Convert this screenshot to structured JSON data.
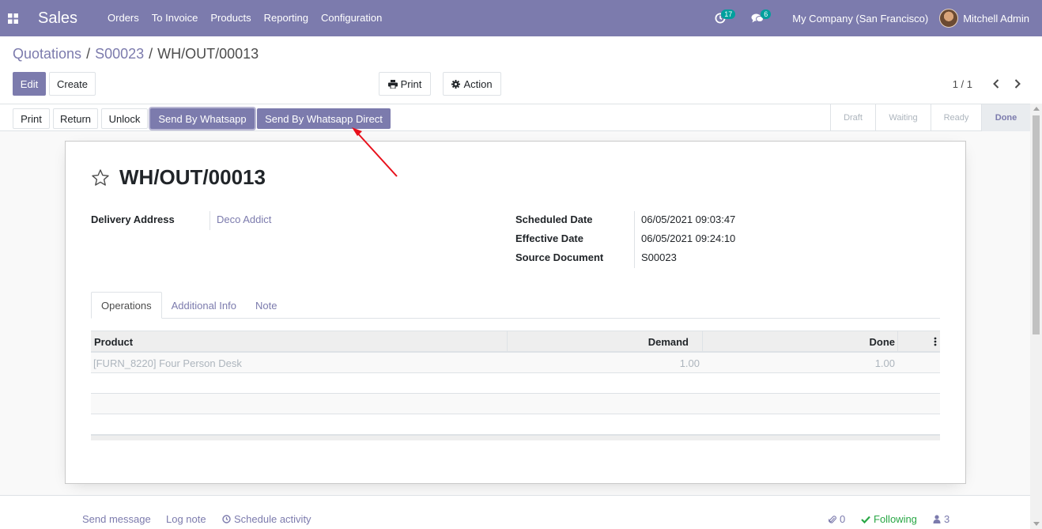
{
  "navbar": {
    "app_name": "Sales",
    "menu": [
      "Orders",
      "To Invoice",
      "Products",
      "Reporting",
      "Configuration"
    ],
    "activity_count": "17",
    "message_count": "6",
    "company": "My Company (San Francisco)",
    "user": "Mitchell Admin"
  },
  "breadcrumb": {
    "items": [
      "Quotations",
      "S00023",
      "WH/OUT/00013"
    ],
    "separator": "/"
  },
  "control_panel": {
    "edit_label": "Edit",
    "create_label": "Create",
    "print_label": "Print",
    "action_label": "Action",
    "pager": "1 / 1"
  },
  "statusbar": {
    "buttons": [
      "Print",
      "Return",
      "Unlock",
      "Send By Whatsapp",
      "Send By Whatsapp Direct"
    ],
    "stages": [
      "Draft",
      "Waiting",
      "Ready",
      "Done"
    ],
    "current_stage": "Done"
  },
  "record": {
    "title": "WH/OUT/00013",
    "delivery_address_label": "Delivery Address",
    "delivery_address": "Deco Addict",
    "scheduled_date_label": "Scheduled Date",
    "scheduled_date": "06/05/2021 09:03:47",
    "effective_date_label": "Effective Date",
    "effective_date": "06/05/2021 09:24:10",
    "source_document_label": "Source Document",
    "source_document": "S00023"
  },
  "tabs": [
    "Operations",
    "Additional Info",
    "Note"
  ],
  "operations": {
    "columns": [
      "Product",
      "Demand",
      "Done"
    ],
    "rows": [
      {
        "product": "[FURN_8220] Four Person Desk",
        "demand": "1.00",
        "done": "1.00"
      }
    ]
  },
  "chatter": {
    "send_message": "Send message",
    "log_note": "Log note",
    "schedule_activity": "Schedule activity",
    "attachments": "0",
    "following": "Following",
    "followers": "3"
  },
  "colors": {
    "brand": "#7c7bad",
    "following": "#28a745",
    "annotation_arrow": "#e8101b"
  }
}
